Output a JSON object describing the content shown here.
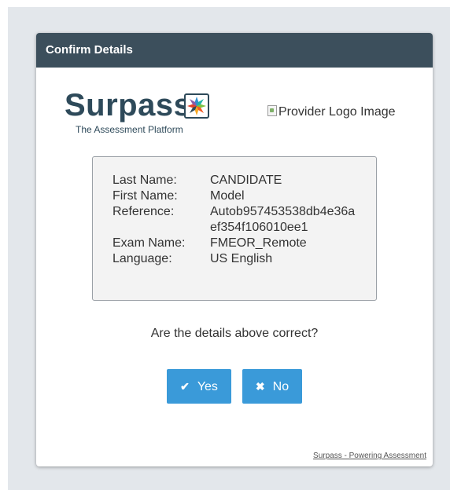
{
  "dialog": {
    "title": "Confirm Details"
  },
  "brand": {
    "name": "Surpass",
    "tagline": "The Assessment Platform",
    "icon": "surpass-logo-icon"
  },
  "provider_logo": {
    "alt_text": "Provider Logo Image"
  },
  "details": [
    {
      "label": "Last Name:",
      "value": "CANDIDATE"
    },
    {
      "label": "First Name:",
      "value": "Model"
    },
    {
      "label": "Reference:",
      "value": "Autob957453538db4e36aef354f106010ee1"
    },
    {
      "label": "Exam Name:",
      "value": "FMEOR_Remote"
    },
    {
      "label": "Language:",
      "value": "US English"
    }
  ],
  "question": "Are the details above correct?",
  "buttons": {
    "yes": {
      "label": "Yes",
      "icon": "✔"
    },
    "no": {
      "label": "No",
      "icon": "✖"
    }
  },
  "footer": {
    "link_text": "Surpass - Powering Assessment"
  },
  "colors": {
    "header": "#3c4f5c",
    "button": "#3a9ad9",
    "brand": "#2e4a5a",
    "backdrop": "#e3e7eb"
  }
}
